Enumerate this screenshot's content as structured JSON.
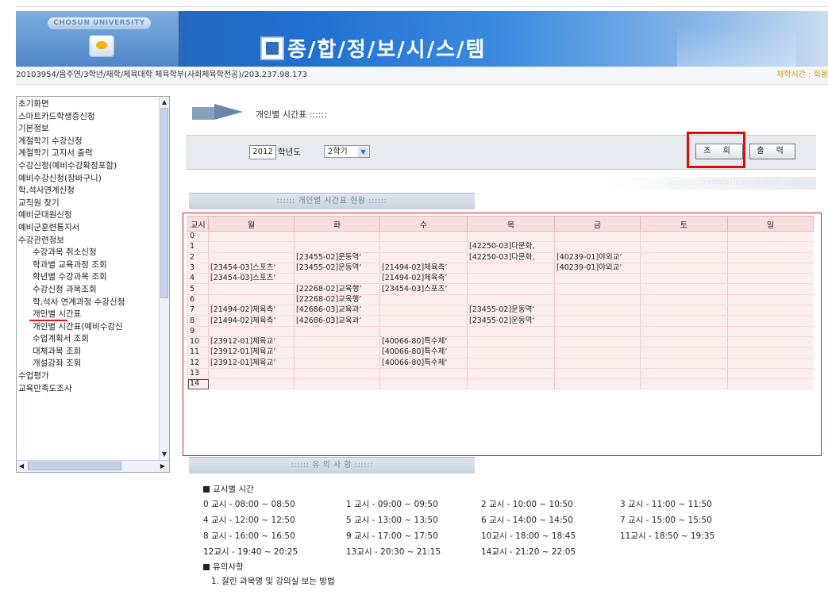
{
  "header": {
    "logo_text": "CHOSUN UNIVERSITY",
    "site_title": "종/합/정/보/시/스/템",
    "user_info": "20103954/음주연/3학년/재학/체육대학 체육학부(사회체육학전공)/203.237.98.173",
    "top_links": "재학시간 : 회봉"
  },
  "sidebar": {
    "items": [
      {
        "label": "초기화면",
        "level": 1
      },
      {
        "label": "스마트카드학생증신청",
        "level": 1
      },
      {
        "label": "기본정보",
        "level": 1
      },
      {
        "label": "계절학기 수강신청",
        "level": 1
      },
      {
        "label": "계절학기 고지서 출력",
        "level": 1
      },
      {
        "label": "수강신청(예비수강확정포함)",
        "level": 1
      },
      {
        "label": "예비수강신청(장바구니)",
        "level": 1
      },
      {
        "label": "학,석사연계신청",
        "level": 1
      },
      {
        "label": "교직원 찾기",
        "level": 1
      },
      {
        "label": "예비군대원신청",
        "level": 1
      },
      {
        "label": "예비군훈련통지서",
        "level": 1
      },
      {
        "label": "수강관련정보",
        "level": 1
      },
      {
        "label": "수강과목 취소신청",
        "level": 2
      },
      {
        "label": "학과별 교육과정 조회",
        "level": 2
      },
      {
        "label": "학년별 수강과목 조회",
        "level": 2
      },
      {
        "label": "수강신청 과목조회",
        "level": 2
      },
      {
        "label": "학,석사 연계과정 수강신청",
        "level": 2
      },
      {
        "label": "개인별 시간표",
        "level": 2
      },
      {
        "label": "개인별 시간표(예비수강신",
        "level": 2
      },
      {
        "label": "수업계획서 조회",
        "level": 2
      },
      {
        "label": "대체과목 조회",
        "level": 2
      },
      {
        "label": "개설강좌 조회",
        "level": 2
      },
      {
        "label": "수업평가",
        "level": 1
      },
      {
        "label": "교육만족도조사",
        "level": 1
      }
    ]
  },
  "page": {
    "breadcrumb": "개인별 시간표 ::::::",
    "year_value": "2012",
    "year_label": "학년도",
    "semester_value": "2학기",
    "query_button": "조 회",
    "print_button": "출 력",
    "univ_label": ":::::::::: CHOSUN UNIVERSITY ::::::::::::",
    "timetable_tab": ":::::: 개인별 시간표 현황 ::::::",
    "notes_tab": ":::::: 유 의 사 항 ::::::"
  },
  "timetable": {
    "headers": [
      "교시",
      "월",
      "화",
      "수",
      "목",
      "금",
      "토",
      "일"
    ],
    "rows": [
      [
        "0",
        "",
        "",
        "",
        "",
        "",
        "",
        ""
      ],
      [
        "1",
        "",
        "",
        "",
        "[42250-03]다문화,",
        "",
        "",
        ""
      ],
      [
        "2",
        "",
        "[23455-02]운동역‘",
        "",
        "[42250-03]다문화,",
        "[40239-01]야외교‘",
        "",
        ""
      ],
      [
        "3",
        "[23454-03]스포츠‘",
        "[23455-02]운동역‘",
        "[21494-02]체육측’",
        "",
        "[40239-01]야외교‘",
        "",
        ""
      ],
      [
        "4",
        "[23454-03]스포츠‘",
        "",
        "[21494-02]체육측’",
        "",
        "",
        "",
        ""
      ],
      [
        "5",
        "",
        "[22268-02]교육행’",
        "[23454-03]스포츠‘",
        "",
        "",
        "",
        ""
      ],
      [
        "6",
        "",
        "[22268-02]교육행’",
        "",
        "",
        "",
        "",
        ""
      ],
      [
        "7",
        "[21494-02]체육측’",
        "[42686-03]교육과’",
        "",
        "[23455-02]운동역‘",
        "",
        "",
        ""
      ],
      [
        "8",
        "[21494-02]체육측’",
        "[42686-03]교육과’",
        "",
        "[23455-02]운동역‘",
        "",
        "",
        ""
      ],
      [
        "9",
        "",
        "",
        "",
        "",
        "",
        "",
        ""
      ],
      [
        "10",
        "[23912-01]체육교’",
        "",
        "[40066-80]특수체‘",
        "",
        "",
        "",
        ""
      ],
      [
        "11",
        "[23912-01]체육교’",
        "",
        "[40066-80]특수체‘",
        "",
        "",
        "",
        ""
      ],
      [
        "12",
        "[23912-01]체육교’",
        "",
        "[40066-80]특수체‘",
        "",
        "",
        "",
        ""
      ],
      [
        "13",
        "",
        "",
        "",
        "",
        "",
        "",
        ""
      ],
      [
        "14",
        "",
        "",
        "",
        "",
        "",
        "",
        ""
      ]
    ]
  },
  "notes": {
    "section1_title": "교시별 시간",
    "periods": [
      [
        "0 교시 - 08:00 ~ 08:50",
        "1 교시 - 09:00 ~ 09:50",
        "2 교시 - 10:00 ~ 10:50",
        "3 교시 - 11:00 ~ 11:50"
      ],
      [
        "4 교시 - 12:00 ~ 12:50",
        "5 교시 - 13:00 ~ 13:50",
        "6 교시 - 14:00 ~ 14:50",
        "7 교시 - 15:00 ~ 15:50"
      ],
      [
        "8 교시 - 16:00 ~ 16:50",
        "9 교시 - 17:00 ~ 17:50",
        "10교시 - 18:00 ~ 18:45",
        "11교시 - 18:50 ~ 19:35"
      ],
      [
        "12교시 - 19:40 ~ 20:25",
        "13교시 - 20:30 ~ 21:15",
        "14교시 - 21:20 ~ 22:05",
        ""
      ]
    ],
    "section2_title": "유의사항",
    "note1": "1. 잘린 과목명 및 강의실 보는 방법"
  },
  "colors": {
    "highlight_red": "#e10a0a",
    "table_bg": "#fdeeee",
    "header_blue": "#1f6fd0"
  }
}
